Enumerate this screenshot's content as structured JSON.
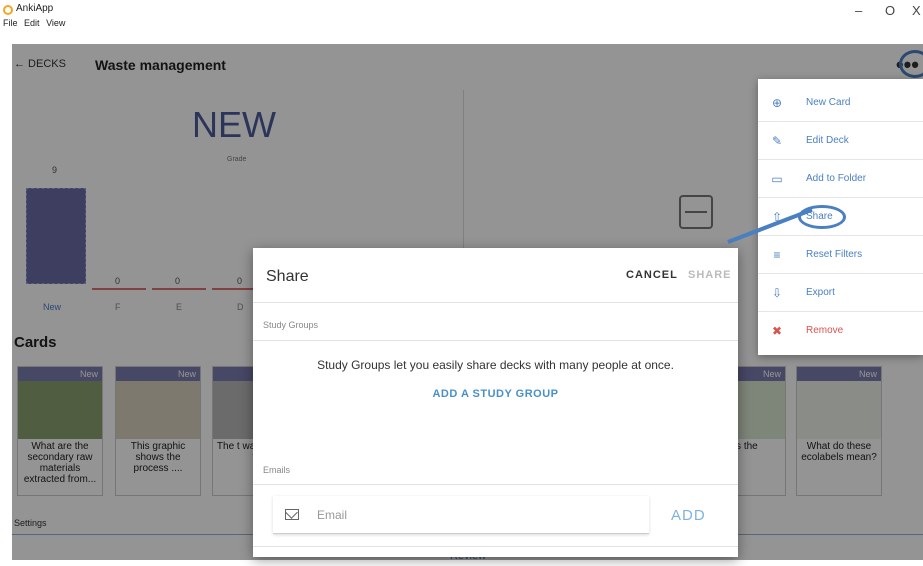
{
  "window": {
    "title": "AnkiApp",
    "menu": [
      "File",
      "Edit",
      "View"
    ],
    "controls": {
      "minimize": "–",
      "maximize": "O",
      "close": "X"
    }
  },
  "header": {
    "back_label": "← DECKS",
    "deck_title": "Waste management",
    "more_icon": "more-horizontal-icon",
    "more_glyph": "•••"
  },
  "stats": {
    "title": "NEW",
    "subtitle": "Grade",
    "bars": [
      {
        "label": "New",
        "value": 9
      },
      {
        "label": "F",
        "value": 0
      },
      {
        "label": "E",
        "value": 0
      },
      {
        "label": "D",
        "value": 0
      }
    ]
  },
  "cards_section": {
    "title": "Cards",
    "cards": [
      {
        "badge": "New",
        "text": "What are the secondary raw materials extracted from..."
      },
      {
        "badge": "New",
        "text": "This graphic shows the process ...."
      },
      {
        "badge": "New",
        "text": "The t waste s the fi"
      },
      {
        "badge": "New",
        "text": "t is the"
      },
      {
        "badge": "New",
        "text": "What do these ecolabels mean?"
      }
    ]
  },
  "footer": {
    "settings": "Settings",
    "review": "Review"
  },
  "menu": {
    "items": [
      {
        "icon": "plus-circle-icon",
        "glyph": "⊕",
        "label": "New Card"
      },
      {
        "icon": "edit-icon",
        "glyph": "✎",
        "label": "Edit Deck"
      },
      {
        "icon": "folder-icon",
        "glyph": "▭",
        "label": "Add to Folder"
      },
      {
        "icon": "share-icon",
        "glyph": "⇧",
        "label": "Share"
      },
      {
        "icon": "filter-icon",
        "glyph": "≡",
        "label": "Reset Filters"
      },
      {
        "icon": "export-icon",
        "glyph": "⇩",
        "label": "Export"
      },
      {
        "icon": "trash-icon",
        "glyph": "✖",
        "label": "Remove"
      }
    ]
  },
  "dialog": {
    "title": "Share",
    "cancel": "CANCEL",
    "share": "SHARE",
    "study_groups_label": "Study Groups",
    "study_groups_desc": "Study Groups let you easily share decks with many people at once.",
    "add_group": "ADD A STUDY GROUP",
    "emails_label": "Emails",
    "email_placeholder": "Email",
    "email_value": "",
    "add": "ADD"
  },
  "colors": {
    "accent": "#4a7fc1",
    "bar": "#6a6ba6",
    "danger": "#d9534f"
  }
}
